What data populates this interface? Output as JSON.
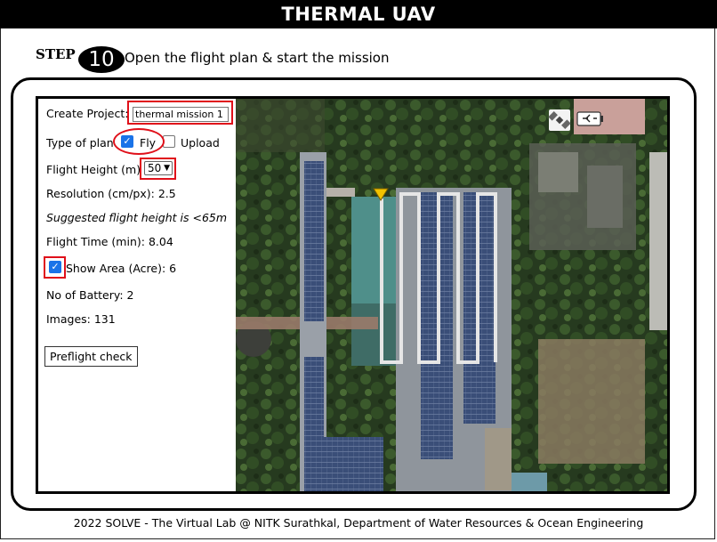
{
  "app_title": "THERMAL UAV",
  "step": {
    "label": "STEP",
    "number": "10",
    "text": "Open the flight plan & start the mission"
  },
  "form": {
    "create_project_label": "Create Project:",
    "project_name_value": "thermal mission 1",
    "plan_type_label": "Type of plan",
    "fly_label": "Fly",
    "fly_checked": true,
    "upload_label": "Upload",
    "upload_checked": false,
    "flight_height_label": "Flight Height (m)",
    "flight_height_value": "50",
    "resolution_text": "Resolution (cm/px): 2.5",
    "suggested_text": "Suggested flight height is <65m",
    "flight_time_text": "Flight Time (min): 8.04",
    "show_area_label": "Show Area (Acre): 6",
    "show_area_checked": true,
    "battery_text": "No of Battery: 2",
    "images_text": "Images: 131",
    "preflight_button": "Preflight check"
  },
  "map": {
    "icons": [
      "satellite-icon",
      "battery-icon"
    ],
    "flight_path_color": "#e6e6e6",
    "marker_color": "#f2c200"
  },
  "footer": "2022 SOLVE - The Virtual Lab @ NITK Surathkal, Department of Water Resources & Ocean Engineering"
}
